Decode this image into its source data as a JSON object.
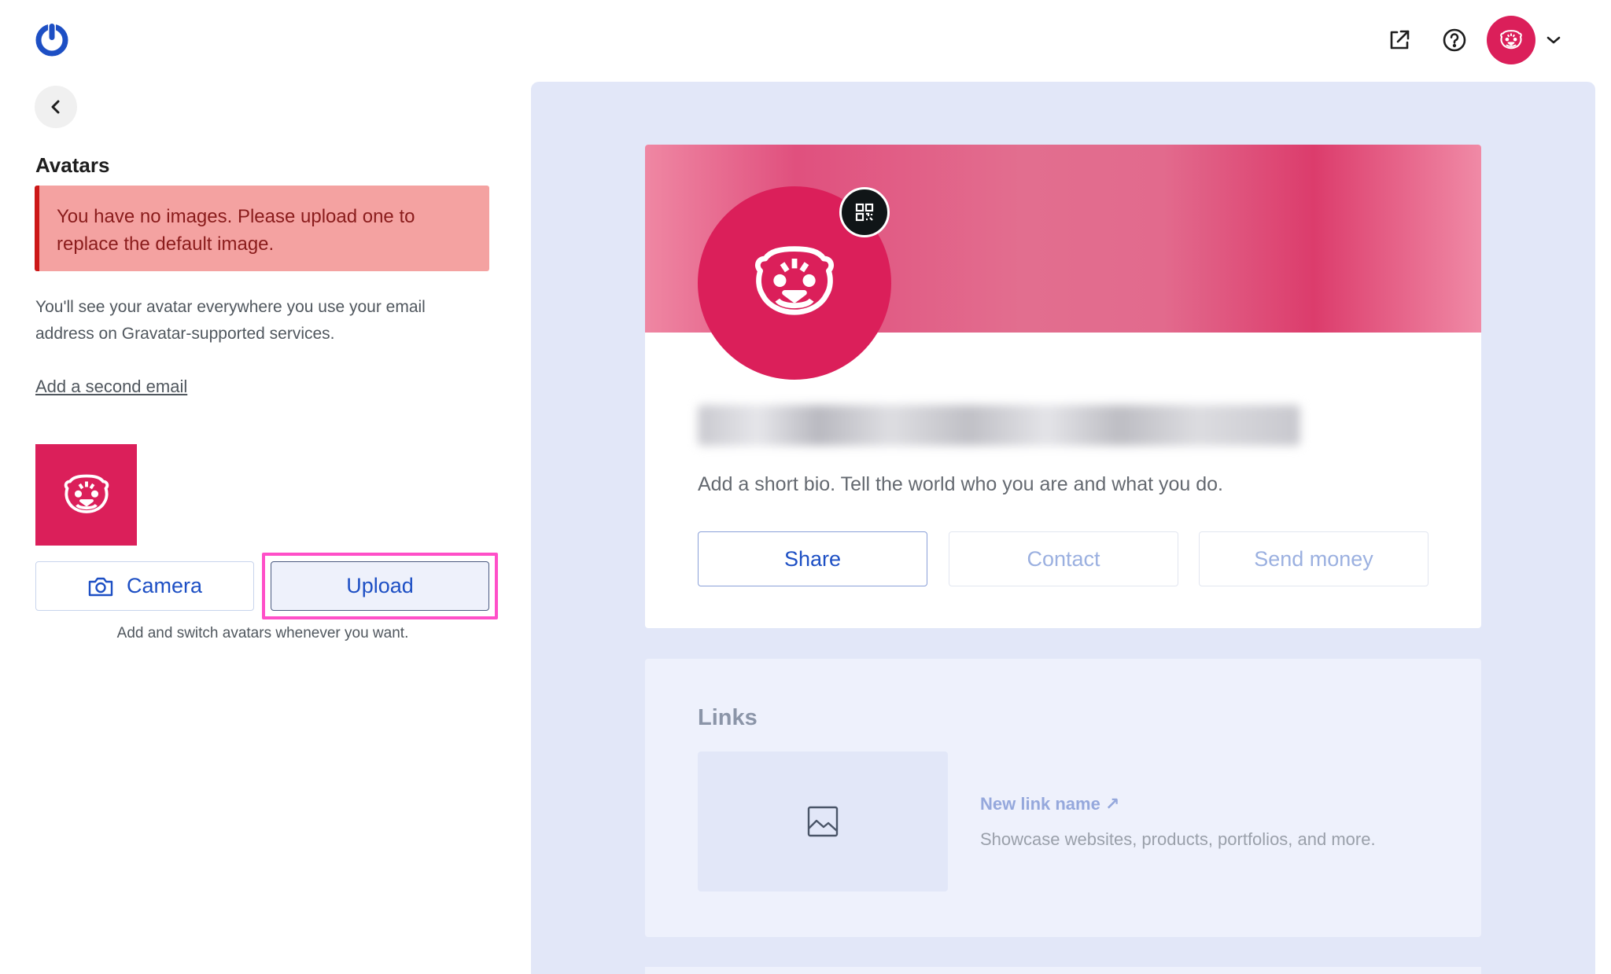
{
  "header": {
    "logo_icon": "power-icon",
    "external_link_icon": "external-link-icon",
    "help_icon": "help-circle-icon",
    "account_avatar_icon": "tiger-icon",
    "menu_caret_icon": "chevron-down-icon"
  },
  "sidebar": {
    "back_icon": "chevron-left-icon",
    "title": "Avatars",
    "notice": "You have no images. Please upload one to replace the default image.",
    "description": "You'll see your avatar everywhere you use your email address on Gravatar-supported services.",
    "second_email_link": "Add a second email",
    "camera_label": "Camera",
    "upload_label": "Upload",
    "caption": "Add and switch avatars whenever you want."
  },
  "preview": {
    "bio": "Add a short bio. Tell the world who you are and what you do.",
    "share_label": "Share",
    "contact_label": "Contact",
    "send_money_label": "Send money",
    "links_title": "Links",
    "link_name": "New link name ↗",
    "link_description": "Showcase websites, products, portfolios, and more."
  },
  "colors": {
    "accent": "#1d4fc4",
    "brand_pink": "#db1f5a",
    "notice_bg": "#f4a2a1",
    "notice_border": "#cc1818",
    "highlight": "#ff4fc8"
  }
}
